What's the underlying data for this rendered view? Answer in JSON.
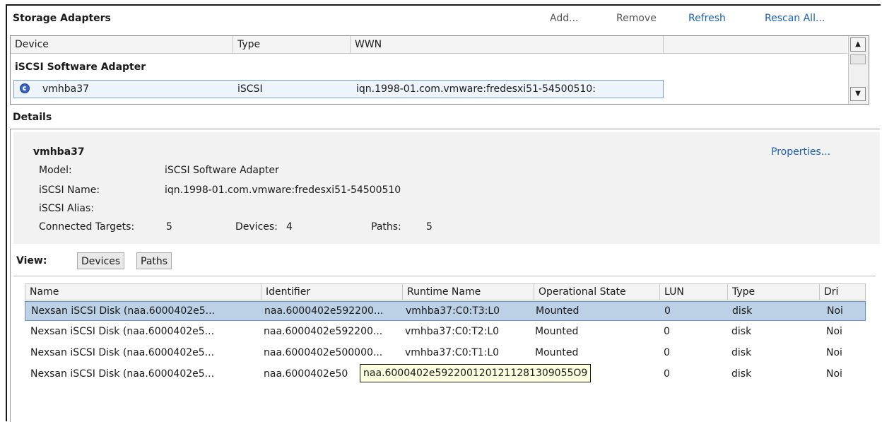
{
  "toolbar": {
    "title": "Storage Adapters",
    "add_label": "Add...",
    "remove_label": "Remove",
    "refresh_label": "Refresh",
    "rescan_label": "Rescan All..."
  },
  "adapters_table": {
    "columns": [
      "Device",
      "Type",
      "WWN"
    ],
    "group_label": "iSCSI Software Adapter",
    "row": {
      "icon": "iscsi-adapter-icon",
      "device": "vmhba37",
      "type": "iSCSI",
      "wwn": "iqn.1998-01.com.vmware:fredesxi51-54500510:"
    }
  },
  "details": {
    "title": "Details",
    "adapter_name": "vmhba37",
    "properties_label": "Properties...",
    "model_label": "Model:",
    "model_value": "iSCSI Software Adapter",
    "iscsi_name_label": "iSCSI Name:",
    "iscsi_name_value": "iqn.1998-01.com.vmware:fredesxi51-54500510",
    "iscsi_alias_label": "iSCSI Alias:",
    "iscsi_alias_value": "",
    "connected_targets_label": "Connected Targets:",
    "connected_targets_value": "5",
    "devices_label": "Devices:",
    "devices_value": "4",
    "paths_label": "Paths:",
    "paths_value": "5",
    "view_label": "View:",
    "view_devices_label": "Devices",
    "view_paths_label": "Paths"
  },
  "devices_table": {
    "columns": [
      "Name",
      "Identifier",
      "Runtime Name",
      "Operational State",
      "LUN",
      "Type",
      "Dri"
    ],
    "rows": [
      {
        "name": "Nexsan iSCSI Disk (naa.6000402e5...",
        "identifier": "naa.6000402e592200...",
        "runtime": "vmhba37:C0:T3:L0",
        "state": "Mounted",
        "lun": "0",
        "type": "disk",
        "drive": "Noi"
      },
      {
        "name": "Nexsan iSCSI Disk (naa.6000402e5...",
        "identifier": "naa.6000402e592200...",
        "runtime": "vmhba37:C0:T2:L0",
        "state": "Mounted",
        "lun": "0",
        "type": "disk",
        "drive": "Noi"
      },
      {
        "name": "Nexsan iSCSI Disk (naa.6000402e5...",
        "identifier": "naa.6000402e500000...",
        "runtime": "vmhba37:C0:T1:L0",
        "state": "Mounted",
        "lun": "0",
        "type": "disk",
        "drive": "Noi"
      },
      {
        "name": "Nexsan iSCSI Disk (naa.6000402e5...",
        "identifier": "naa.6000402e50",
        "runtime": "",
        "state": "",
        "lun": "0",
        "type": "disk",
        "drive": "Noi"
      }
    ]
  },
  "tooltip": {
    "text": "naa.6000402e5922001201211281309055O9"
  },
  "colors": {
    "link": "#1a5fb4",
    "selection": "#bcd0e6",
    "tooltip_bg": "#ffffe1"
  }
}
